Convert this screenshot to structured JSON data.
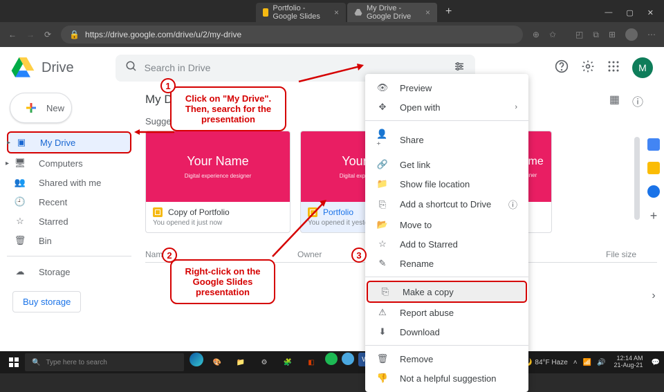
{
  "browser": {
    "tabs": [
      {
        "title": "Portfolio - Google Slides",
        "icon_bg": "#f5b912"
      },
      {
        "title": "My Drive - Google Drive",
        "icon_bg": "#ffffff"
      }
    ],
    "new_tab": "+",
    "url": "https://drive.google.com/drive/u/2/my-drive",
    "window_controls": {
      "min": "—",
      "max": "▢",
      "close": "✕"
    }
  },
  "drive": {
    "app_name": "Drive",
    "search_placeholder": "Search in Drive",
    "avatar_letter": "M",
    "new_button": "New",
    "nav": [
      {
        "label": "My Drive",
        "icon": "▢",
        "active": true,
        "expandable": true
      },
      {
        "label": "Computers",
        "icon": "🖥",
        "expandable": true
      },
      {
        "label": "Shared with me",
        "icon": "👥"
      },
      {
        "label": "Recent",
        "icon": "🕘"
      },
      {
        "label": "Starred",
        "icon": "☆"
      },
      {
        "label": "Bin",
        "icon": "🗑"
      }
    ],
    "storage_label": "Storage",
    "buy_storage": "Buy storage",
    "breadcrumb": "My Drive",
    "suggested": "Suggested",
    "cards": [
      {
        "thumb_title": "Your Name",
        "thumb_sub": "Digital experience designer",
        "name": "Copy of Portfolio",
        "meta": "You opened it just now"
      },
      {
        "thumb_title": "Your Name",
        "thumb_sub": "Digital experience designer",
        "name": "Portfolio",
        "meta": "You opened it yesterday"
      },
      {
        "thumb_title": "Your Name",
        "thumb_sub": "Digital experience designer",
        "name": "",
        "meta": ""
      }
    ],
    "columns": {
      "name": "Name",
      "owner": "Owner",
      "size": "File size"
    }
  },
  "context_menu": {
    "items": [
      {
        "label": "Preview",
        "icon": "👁"
      },
      {
        "label": "Open with",
        "icon": "✥",
        "chevron": true
      },
      {
        "divider": true
      },
      {
        "label": "Share",
        "icon": "👤+"
      },
      {
        "label": "Get link",
        "icon": "🔗"
      },
      {
        "label": "Show file location",
        "icon": "📁"
      },
      {
        "label": "Add a shortcut to Drive",
        "icon": "⎘",
        "help": true
      },
      {
        "label": "Move to",
        "icon": "📂"
      },
      {
        "label": "Add to Starred",
        "icon": "☆"
      },
      {
        "label": "Rename",
        "icon": "✎"
      },
      {
        "divider": true
      },
      {
        "label": "Make a copy",
        "icon": "⎘",
        "highlight": true
      },
      {
        "label": "Report abuse",
        "icon": "⚠"
      },
      {
        "label": "Download",
        "icon": "⬇"
      },
      {
        "divider": true
      },
      {
        "label": "Remove",
        "icon": "🗑"
      },
      {
        "label": "Not a helpful suggestion",
        "icon": "👎"
      }
    ]
  },
  "annotations": {
    "b1": "1",
    "c1": "Click on \"My Drive\". Then, search for the presentation",
    "b2": "2",
    "c2": "Right-click on the Google Slides presentation",
    "b3": "3"
  },
  "taskbar": {
    "search_placeholder": "Type here to search",
    "weather": "84°F Haze",
    "time": "12:14 AM",
    "date": "21-Aug-21"
  }
}
